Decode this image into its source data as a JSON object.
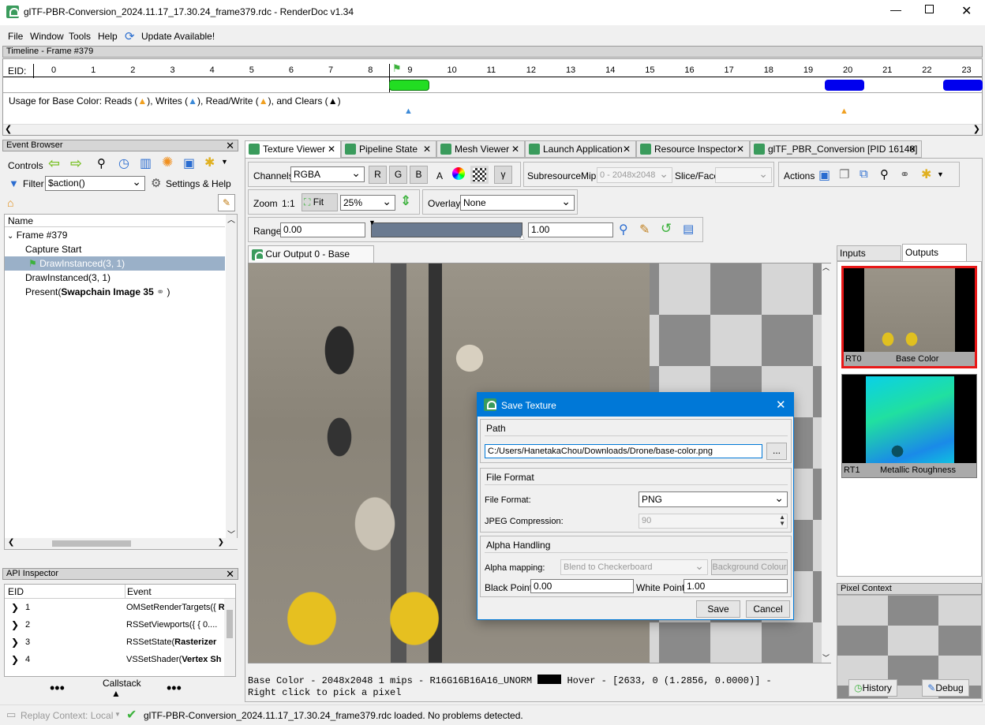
{
  "window": {
    "title": "glTF-PBR-Conversion_2024.11.17_17.30.24_frame379.rdc - RenderDoc v1.34"
  },
  "menu": {
    "file": "File",
    "window": "Window",
    "tools": "Tools",
    "help": "Help",
    "update": "Update Available!"
  },
  "timeline": {
    "title": "Timeline - Frame #379",
    "eid_label": "EID:",
    "ticks": [
      "0",
      "1",
      "2",
      "3",
      "4",
      "5",
      "6",
      "7",
      "8",
      "9",
      "10",
      "11",
      "12",
      "13",
      "14",
      "15",
      "16",
      "17",
      "18",
      "19",
      "20",
      "21",
      "22",
      "23"
    ],
    "usage": "Usage for Base Color: Reads (",
    "usage2": "), Writes (",
    "usage3": "), Read/Write (",
    "usage4": "), and Clears ("
  },
  "event_browser": {
    "title": "Event Browser",
    "controls": "Controls",
    "filter_label": "Filter",
    "filter_value": "$action()",
    "settings": "Settings & Help",
    "col_name": "Name",
    "frame": "Frame #379",
    "capture_start": "Capture Start",
    "draw1": "DrawInstanced(3, 1)",
    "draw2": "DrawInstanced(3, 1)",
    "present_pre": "Present(",
    "present_bold": "Swapchain Image 35",
    "present_post": ")"
  },
  "api_inspector": {
    "title": "API Inspector",
    "col_eid": "EID",
    "col_event": "Event",
    "rows": [
      {
        "eid": "1",
        "pre": "OMSetRenderTargets({ ",
        "bold": "R"
      },
      {
        "eid": "2",
        "pre": "RSSetViewports({ { 0....",
        "bold": ""
      },
      {
        "eid": "3",
        "pre": "RSSetState(",
        "bold": "Rasterizer"
      },
      {
        "eid": "4",
        "pre": "VSSetShader(",
        "bold": "Vertex Sh"
      }
    ],
    "callstack": "Callstack"
  },
  "tabs": [
    "Texture Viewer",
    "Pipeline State",
    "Mesh Viewer",
    "Launch Application",
    "Resource Inspector",
    "glTF_PBR_Conversion [PID 16140]"
  ],
  "toolbar": {
    "channels": "Channels",
    "channels_value": "RGBA",
    "r": "R",
    "g": "G",
    "b": "B",
    "a": "A",
    "gamma": "γ",
    "subresource": "Subresource",
    "mip": "Mip",
    "mip_value": "0 - 2048x2048",
    "slice": "Slice/Face",
    "actions": "Actions",
    "zoom": "Zoom",
    "one_to_one": "1:1",
    "fit": "Fit",
    "zoom_value": "25%",
    "overlay": "Overlay",
    "overlay_value": "None",
    "range": "Range",
    "range_min": "0.00",
    "range_max": "1.00"
  },
  "viewer": {
    "tab": "Cur Output 0 - Base Color",
    "status_line1": "Base Color - 2048x2048 1 mips - R16G16B16A16_UNORM",
    "status_hover": "Hover - [2633,    0 (1.2856, 0.0000)] -",
    "status_line2": "Right click to pick a pixel"
  },
  "thumbs": {
    "inputs": "Inputs",
    "outputs": "Outputs",
    "rt0": "RT0",
    "rt0_name": "Base Color",
    "rt1": "RT1",
    "rt1_name": "Metallic Roughness"
  },
  "pixel_context": {
    "title": "Pixel Context",
    "history": "History",
    "debug": "Debug"
  },
  "dialog": {
    "title": "Save Texture",
    "path_group": "Path",
    "path_value": "C:/Users/HanetakaChou/Downloads/Drone/base-color.png",
    "browse": "...",
    "format_group": "File Format",
    "format_label": "File Format:",
    "format_value": "PNG",
    "jpeg_label": "JPEG Compression:",
    "jpeg_value": "90",
    "alpha_group": "Alpha Handling",
    "alpha_label": "Alpha mapping:",
    "alpha_value": "Blend to Checkerboard",
    "bg_colour": "Background Colour",
    "black_label": "Black Point:",
    "black_value": "0.00",
    "white_label": "White Point:",
    "white_value": "1.00",
    "save": "Save",
    "cancel": "Cancel"
  },
  "statusbar": {
    "replay": "Replay Context: Local",
    "message": "glTF-PBR-Conversion_2024.11.17_17.30.24_frame379.rdc loaded. No problems detected."
  },
  "colors": {
    "accent": "#0078d7",
    "green": "#22dd22",
    "blue": "#0000ee",
    "selected": "#9ab0c8"
  }
}
